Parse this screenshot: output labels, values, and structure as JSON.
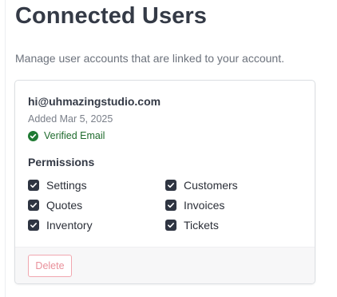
{
  "header": {
    "title": "Connected Users",
    "subtitle": "Manage user accounts that are linked to your account."
  },
  "user": {
    "email": "hi@uhmazingstudio.com",
    "added": "Added Mar 5, 2025",
    "verified_label": "Verified Email"
  },
  "permissions": {
    "heading": "Permissions",
    "items": [
      {
        "label": "Settings",
        "checked": true
      },
      {
        "label": "Quotes",
        "checked": true
      },
      {
        "label": "Inventory",
        "checked": true
      },
      {
        "label": "Customers",
        "checked": true
      },
      {
        "label": "Invoices",
        "checked": true
      },
      {
        "label": "Tickets",
        "checked": true
      }
    ]
  },
  "footer": {
    "delete_label": "Delete"
  },
  "icons": {
    "verified": "check-circle-icon",
    "checkbox": "checkmark-icon"
  },
  "colors": {
    "title": "#343a46",
    "verified_green": "#1f6b2d",
    "checkbox_fill": "#2f3542",
    "delete_border": "#f1a7af",
    "delete_text": "#e9909a"
  }
}
